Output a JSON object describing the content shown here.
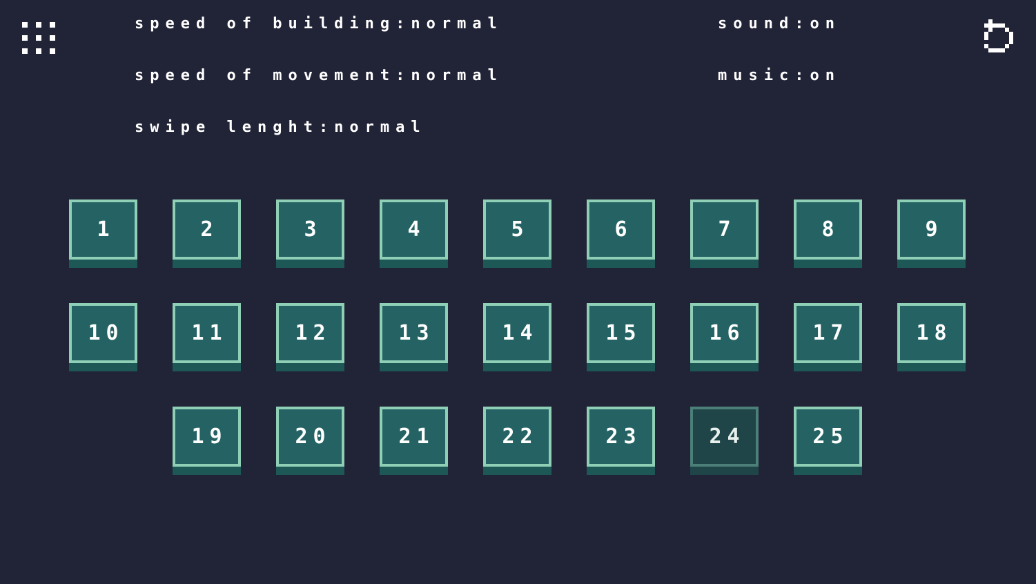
{
  "settings": {
    "speed_of_building": "speed of building:normal",
    "speed_of_movement": "speed of movement:normal",
    "swipe_length": "swipe lenght:normal",
    "sound": "sound:on",
    "music": "music:on"
  },
  "icons": {
    "menu": "grid-menu-icon",
    "back": "undo-arrow-icon"
  },
  "levels": [
    "1",
    "2",
    "3",
    "4",
    "5",
    "6",
    "7",
    "8",
    "9",
    "10",
    "11",
    "12",
    "13",
    "14",
    "15",
    "16",
    "17",
    "18",
    "19",
    "20",
    "21",
    "22",
    "23",
    "24",
    "25"
  ],
  "current_level": "24",
  "colors": {
    "background": "#212337",
    "tile_fill": "#246263",
    "tile_border": "#8ecfb6",
    "tile_current": "#1f4549"
  }
}
